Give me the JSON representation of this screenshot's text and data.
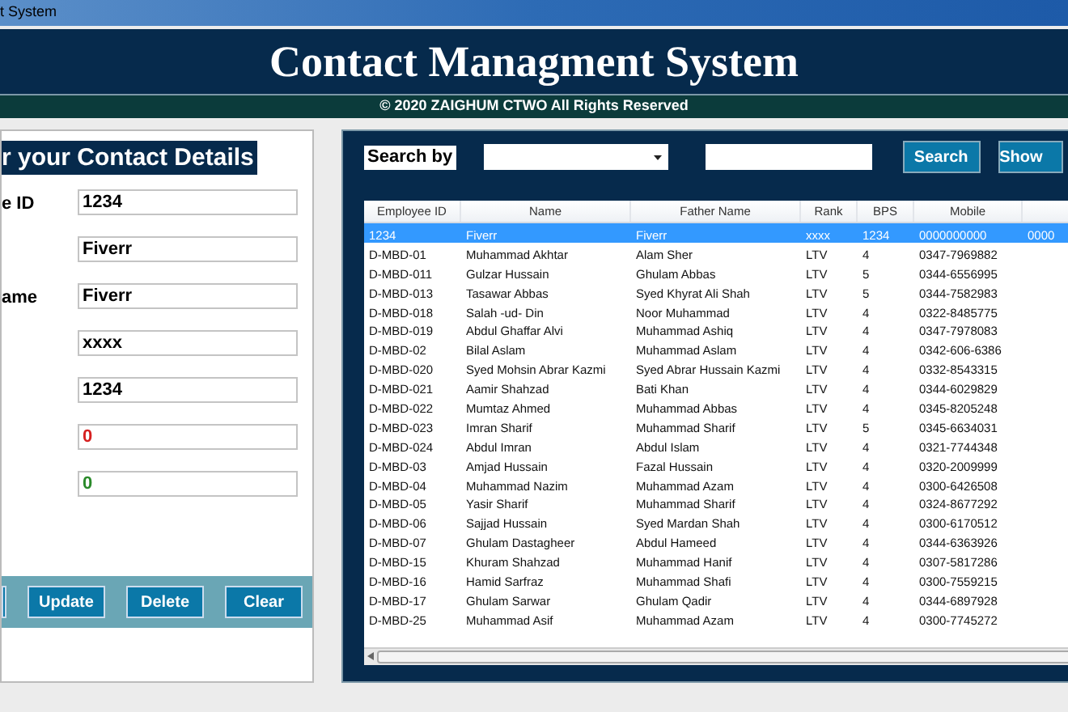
{
  "window": {
    "title": "t System"
  },
  "header": {
    "title": "Contact Managment System",
    "footer": "© 2020 ZAIGHUM CTWO All Rights Reserved"
  },
  "form": {
    "heading": "r your Contact Details",
    "fields": [
      {
        "label": "e ID",
        "value": "1234",
        "color": "#000000"
      },
      {
        "value": "Fiverr",
        "color": "#000000"
      },
      {
        "label": "ame",
        "value": "Fiverr",
        "color": "#000000"
      },
      {
        "value": "xxxx",
        "color": "#000000"
      },
      {
        "value": "1234",
        "color": "#000000"
      },
      {
        "value": "0",
        "color": "#d62020"
      },
      {
        "value": "0",
        "color": "#2a8a2a"
      }
    ],
    "buttons": [
      {
        "kind": "partial"
      },
      {
        "kind": "full",
        "label": "Update"
      },
      {
        "kind": "full",
        "label": "Delete"
      },
      {
        "kind": "full",
        "label": "Clear"
      }
    ]
  },
  "search": {
    "label": "Search by",
    "buttons": [
      "Search",
      "Show"
    ]
  },
  "table": {
    "columns": [
      "Employee ID",
      "Name",
      "Father Name",
      "Rank",
      "BPS",
      "Mobile",
      null
    ],
    "rows": [
      {
        "selected": true,
        "cells": [
          "1234",
          "Fiverr",
          "Fiverr",
          "xxxx",
          "1234",
          "0000000000",
          "0000"
        ]
      },
      {
        "selected": false,
        "cells": [
          "D-MBD-01",
          "Muhammad Akhtar",
          "Alam Sher",
          "LTV",
          "4",
          "0347-7969882",
          ""
        ]
      },
      {
        "selected": false,
        "cells": [
          "D-MBD-011",
          "Gulzar Hussain",
          "Ghulam Abbas",
          "LTV",
          "5",
          "0344-6556995",
          ""
        ]
      },
      {
        "selected": false,
        "cells": [
          "D-MBD-013",
          "Tasawar Abbas",
          "Syed Khyrat Ali Shah",
          "LTV",
          "5",
          "0344-7582983",
          ""
        ]
      },
      {
        "selected": false,
        "cells": [
          "D-MBD-018",
          "Salah -ud- Din",
          "Noor Muhammad",
          "LTV",
          "4",
          "0322-8485775",
          ""
        ]
      },
      {
        "selected": false,
        "cells": [
          "D-MBD-019",
          "Abdul Ghaffar Alvi",
          "Muhammad Ashiq",
          "LTV",
          "4",
          "0347-7978083",
          ""
        ]
      },
      {
        "selected": false,
        "cells": [
          "D-MBD-02",
          "Bilal Aslam",
          "Muhammad Aslam",
          "LTV",
          "4",
          "0342-606-6386",
          ""
        ]
      },
      {
        "selected": false,
        "cells": [
          "D-MBD-020",
          "Syed Mohsin Abrar Kazmi",
          "Syed Abrar Hussain Kazmi",
          "LTV",
          "4",
          "0332-8543315",
          ""
        ]
      },
      {
        "selected": false,
        "cells": [
          "D-MBD-021",
          "Aamir Shahzad",
          "Bati Khan",
          "LTV",
          "4",
          "0344-6029829",
          ""
        ]
      },
      {
        "selected": false,
        "cells": [
          "D-MBD-022",
          "Mumtaz Ahmed",
          "Muhammad Abbas",
          "LTV",
          "4",
          "0345-8205248",
          ""
        ]
      },
      {
        "selected": false,
        "cells": [
          "D-MBD-023",
          "Imran Sharif",
          "Muhammad Sharif",
          "LTV",
          "5",
          "0345-6634031",
          ""
        ]
      },
      {
        "selected": false,
        "cells": [
          "D-MBD-024",
          "Abdul Imran",
          "Abdul Islam",
          "LTV",
          "4",
          "0321-7744348",
          ""
        ]
      },
      {
        "selected": false,
        "cells": [
          "D-MBD-03",
          "Amjad Hussain",
          "Fazal Hussain",
          "LTV",
          "4",
          "0320-2009999",
          ""
        ]
      },
      {
        "selected": false,
        "cells": [
          "D-MBD-04",
          "Muhammad Nazim",
          "Muhammad Azam",
          "LTV",
          "4",
          "0300-6426508",
          ""
        ]
      },
      {
        "selected": false,
        "cells": [
          "D-MBD-05",
          "Yasir Sharif",
          "Muhammad Sharif",
          "LTV",
          "4",
          "0324-8677292",
          ""
        ]
      },
      {
        "selected": false,
        "cells": [
          "D-MBD-06",
          "Sajjad Hussain",
          "Syed Mardan Shah",
          "LTV",
          "4",
          "0300-6170512",
          ""
        ]
      },
      {
        "selected": false,
        "cells": [
          "D-MBD-07",
          "Ghulam Dastagheer",
          "Abdul Hameed",
          "LTV",
          "4",
          "0344-6363926",
          ""
        ]
      },
      {
        "selected": false,
        "cells": [
          "D-MBD-15",
          "Khuram Shahzad",
          "Muhammad Hanif",
          "LTV",
          "4",
          "0307-5817286",
          ""
        ]
      },
      {
        "selected": false,
        "cells": [
          "D-MBD-16",
          "Hamid Sarfraz",
          "Muhammad Shafi",
          "LTV",
          "4",
          "0300-7559215",
          ""
        ]
      },
      {
        "selected": false,
        "cells": [
          "D-MBD-17",
          "Ghulam Sarwar",
          "Ghulam Qadir",
          "LTV",
          "4",
          "0344-6897928",
          ""
        ]
      },
      {
        "selected": false,
        "cells": [
          "D-MBD-25",
          "Muhammad Asif",
          "Muhammad Azam",
          "LTV",
          "4",
          "0300-7745272",
          ""
        ]
      }
    ]
  }
}
